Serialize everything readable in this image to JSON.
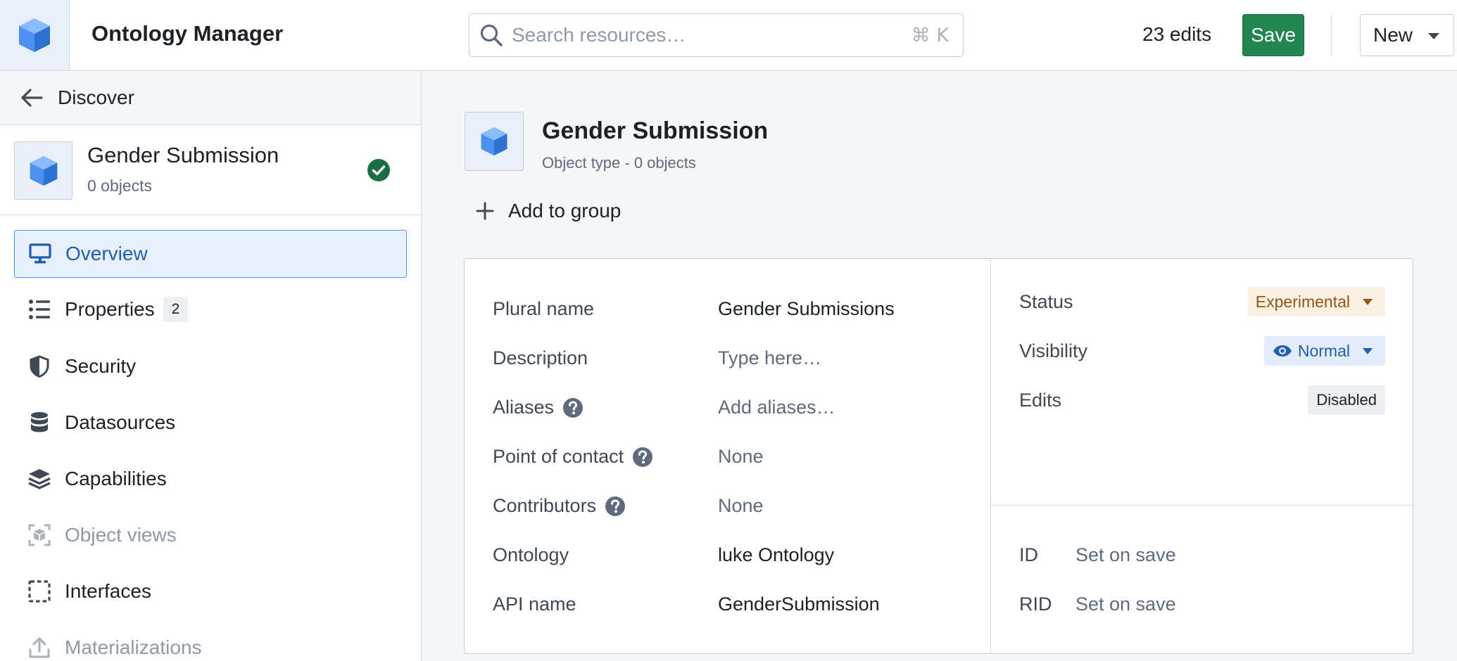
{
  "app": {
    "title": "Ontology Manager"
  },
  "search": {
    "placeholder": "Search resources…",
    "shortcut": "⌘ K"
  },
  "header": {
    "edits": "23 edits",
    "save_label": "Save",
    "new_label": "New"
  },
  "sidebar": {
    "back_label": "Discover",
    "entity": {
      "name": "Gender Submission",
      "count": "0 objects",
      "status_icon": "check-circle-icon"
    },
    "items": [
      {
        "label": "Overview",
        "icon": "monitor-icon",
        "active": true
      },
      {
        "label": "Properties",
        "icon": "list-icon",
        "badge": "2"
      },
      {
        "label": "Security",
        "icon": "shield-icon"
      },
      {
        "label": "Datasources",
        "icon": "database-icon"
      },
      {
        "label": "Capabilities",
        "icon": "layers-icon"
      },
      {
        "label": "Object views",
        "icon": "object-view-icon",
        "disabled": true
      },
      {
        "label": "Interfaces",
        "icon": "dashed-square-icon"
      },
      {
        "label": "Materializations",
        "icon": "upload-icon",
        "disabled": true
      }
    ]
  },
  "main": {
    "title": "Gender Submission",
    "subtitle": "Object type - 0 objects",
    "add_group_label": "Add to group",
    "properties": [
      {
        "key": "Plural name",
        "value": "Gender Submissions"
      },
      {
        "key": "Description",
        "value": "Type here…",
        "placeholder": true
      },
      {
        "key": "Aliases",
        "value": "Add aliases…",
        "help": true,
        "placeholder": true
      },
      {
        "key": "Point of contact",
        "value": "None",
        "help": true,
        "placeholder": true
      },
      {
        "key": "Contributors",
        "value": "None",
        "help": true,
        "placeholder": true
      },
      {
        "key": "Ontology",
        "value": "luke Ontology"
      },
      {
        "key": "API name",
        "value": "GenderSubmission"
      }
    ],
    "status": {
      "label": "Status",
      "value": "Experimental"
    },
    "visibility": {
      "label": "Visibility",
      "value": "Normal"
    },
    "edits": {
      "label": "Edits",
      "value": "Disabled"
    },
    "id": {
      "label": "ID",
      "value": "Set on save"
    },
    "rid": {
      "label": "RID",
      "value": "Set on save"
    }
  },
  "colors": {
    "accent": "#215db0",
    "save": "#238551",
    "experimental_bg": "#fbf1e5",
    "experimental_fg": "#935610",
    "success": "#1c6e42"
  }
}
